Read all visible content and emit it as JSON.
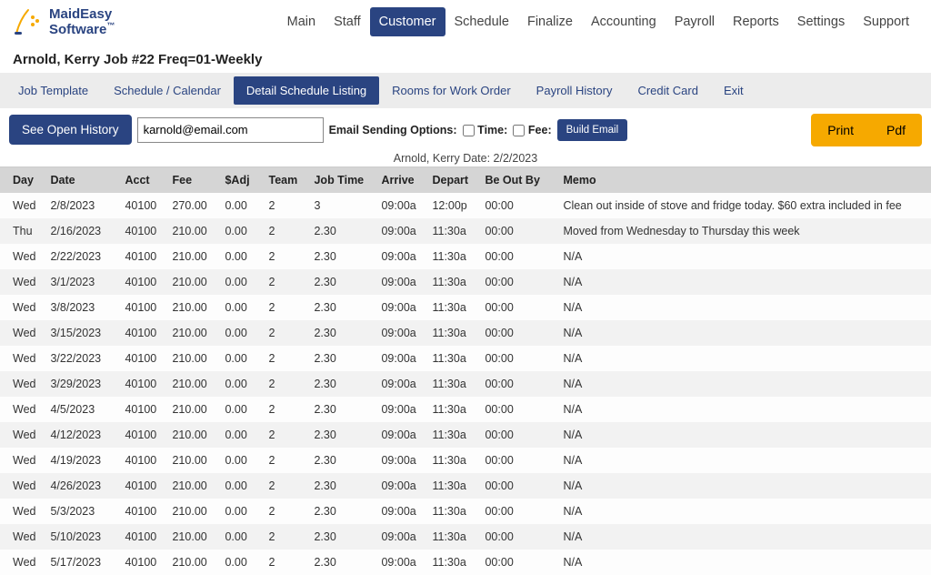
{
  "logo": {
    "line1": "MaidEasy",
    "line2": "Software",
    "tm": "™"
  },
  "topnav": [
    {
      "label": "Main"
    },
    {
      "label": "Staff"
    },
    {
      "label": "Customer",
      "active": true
    },
    {
      "label": "Schedule"
    },
    {
      "label": "Finalize"
    },
    {
      "label": "Accounting"
    },
    {
      "label": "Payroll"
    },
    {
      "label": "Reports"
    },
    {
      "label": "Settings"
    },
    {
      "label": "Support"
    }
  ],
  "page_title": "Arnold, Kerry Job #22 Freq=01-Weekly",
  "tabs": [
    {
      "label": "Job Template"
    },
    {
      "label": "Schedule / Calendar"
    },
    {
      "label": "Detail Schedule Listing",
      "active": true
    },
    {
      "label": "Rooms for Work Order"
    },
    {
      "label": "Payroll History"
    },
    {
      "label": "Credit Card"
    },
    {
      "label": "Exit"
    }
  ],
  "actions": {
    "open_history": "See Open History",
    "email_value": "karnold@email.com",
    "email_opts_label": "Email Sending Options:",
    "time_label": "Time:",
    "fee_label": "Fee:",
    "build_email": "Build Email",
    "print": "Print",
    "pdf": "Pdf"
  },
  "subheader": "Arnold, Kerry Date: 2/2/2023",
  "columns": {
    "day": "Day",
    "date": "Date",
    "acct": "Acct",
    "fee": "Fee",
    "adj": "$Adj",
    "team": "Team",
    "job": "Job Time",
    "arrive": "Arrive",
    "depart": "Depart",
    "out": "Be Out By",
    "memo": "Memo"
  },
  "rows": [
    {
      "day": "Wed",
      "date": "2/8/2023",
      "acct": "40100",
      "fee": "270.00",
      "adj": "0.00",
      "team": "2",
      "job": "3",
      "arrive": "09:00a",
      "depart": "12:00p",
      "out": "00:00",
      "memo": "Clean out inside of stove and fridge today. $60 extra included in fee"
    },
    {
      "day": "Thu",
      "date": "2/16/2023",
      "acct": "40100",
      "fee": "210.00",
      "adj": "0.00",
      "team": "2",
      "job": "2.30",
      "arrive": "09:00a",
      "depart": "11:30a",
      "out": "00:00",
      "memo": "Moved from Wednesday to Thursday this week"
    },
    {
      "day": "Wed",
      "date": "2/22/2023",
      "acct": "40100",
      "fee": "210.00",
      "adj": "0.00",
      "team": "2",
      "job": "2.30",
      "arrive": "09:00a",
      "depart": "11:30a",
      "out": "00:00",
      "memo": "N/A"
    },
    {
      "day": "Wed",
      "date": "3/1/2023",
      "acct": "40100",
      "fee": "210.00",
      "adj": "0.00",
      "team": "2",
      "job": "2.30",
      "arrive": "09:00a",
      "depart": "11:30a",
      "out": "00:00",
      "memo": "N/A"
    },
    {
      "day": "Wed",
      "date": "3/8/2023",
      "acct": "40100",
      "fee": "210.00",
      "adj": "0.00",
      "team": "2",
      "job": "2.30",
      "arrive": "09:00a",
      "depart": "11:30a",
      "out": "00:00",
      "memo": "N/A"
    },
    {
      "day": "Wed",
      "date": "3/15/2023",
      "acct": "40100",
      "fee": "210.00",
      "adj": "0.00",
      "team": "2",
      "job": "2.30",
      "arrive": "09:00a",
      "depart": "11:30a",
      "out": "00:00",
      "memo": "N/A"
    },
    {
      "day": "Wed",
      "date": "3/22/2023",
      "acct": "40100",
      "fee": "210.00",
      "adj": "0.00",
      "team": "2",
      "job": "2.30",
      "arrive": "09:00a",
      "depart": "11:30a",
      "out": "00:00",
      "memo": "N/A"
    },
    {
      "day": "Wed",
      "date": "3/29/2023",
      "acct": "40100",
      "fee": "210.00",
      "adj": "0.00",
      "team": "2",
      "job": "2.30",
      "arrive": "09:00a",
      "depart": "11:30a",
      "out": "00:00",
      "memo": "N/A"
    },
    {
      "day": "Wed",
      "date": "4/5/2023",
      "acct": "40100",
      "fee": "210.00",
      "adj": "0.00",
      "team": "2",
      "job": "2.30",
      "arrive": "09:00a",
      "depart": "11:30a",
      "out": "00:00",
      "memo": "N/A"
    },
    {
      "day": "Wed",
      "date": "4/12/2023",
      "acct": "40100",
      "fee": "210.00",
      "adj": "0.00",
      "team": "2",
      "job": "2.30",
      "arrive": "09:00a",
      "depart": "11:30a",
      "out": "00:00",
      "memo": "N/A"
    },
    {
      "day": "Wed",
      "date": "4/19/2023",
      "acct": "40100",
      "fee": "210.00",
      "adj": "0.00",
      "team": "2",
      "job": "2.30",
      "arrive": "09:00a",
      "depart": "11:30a",
      "out": "00:00",
      "memo": "N/A"
    },
    {
      "day": "Wed",
      "date": "4/26/2023",
      "acct": "40100",
      "fee": "210.00",
      "adj": "0.00",
      "team": "2",
      "job": "2.30",
      "arrive": "09:00a",
      "depart": "11:30a",
      "out": "00:00",
      "memo": "N/A"
    },
    {
      "day": "Wed",
      "date": "5/3/2023",
      "acct": "40100",
      "fee": "210.00",
      "adj": "0.00",
      "team": "2",
      "job": "2.30",
      "arrive": "09:00a",
      "depart": "11:30a",
      "out": "00:00",
      "memo": "N/A"
    },
    {
      "day": "Wed",
      "date": "5/10/2023",
      "acct": "40100",
      "fee": "210.00",
      "adj": "0.00",
      "team": "2",
      "job": "2.30",
      "arrive": "09:00a",
      "depart": "11:30a",
      "out": "00:00",
      "memo": "N/A"
    },
    {
      "day": "Wed",
      "date": "5/17/2023",
      "acct": "40100",
      "fee": "210.00",
      "adj": "0.00",
      "team": "2",
      "job": "2.30",
      "arrive": "09:00a",
      "depart": "11:30a",
      "out": "00:00",
      "memo": "N/A"
    }
  ]
}
